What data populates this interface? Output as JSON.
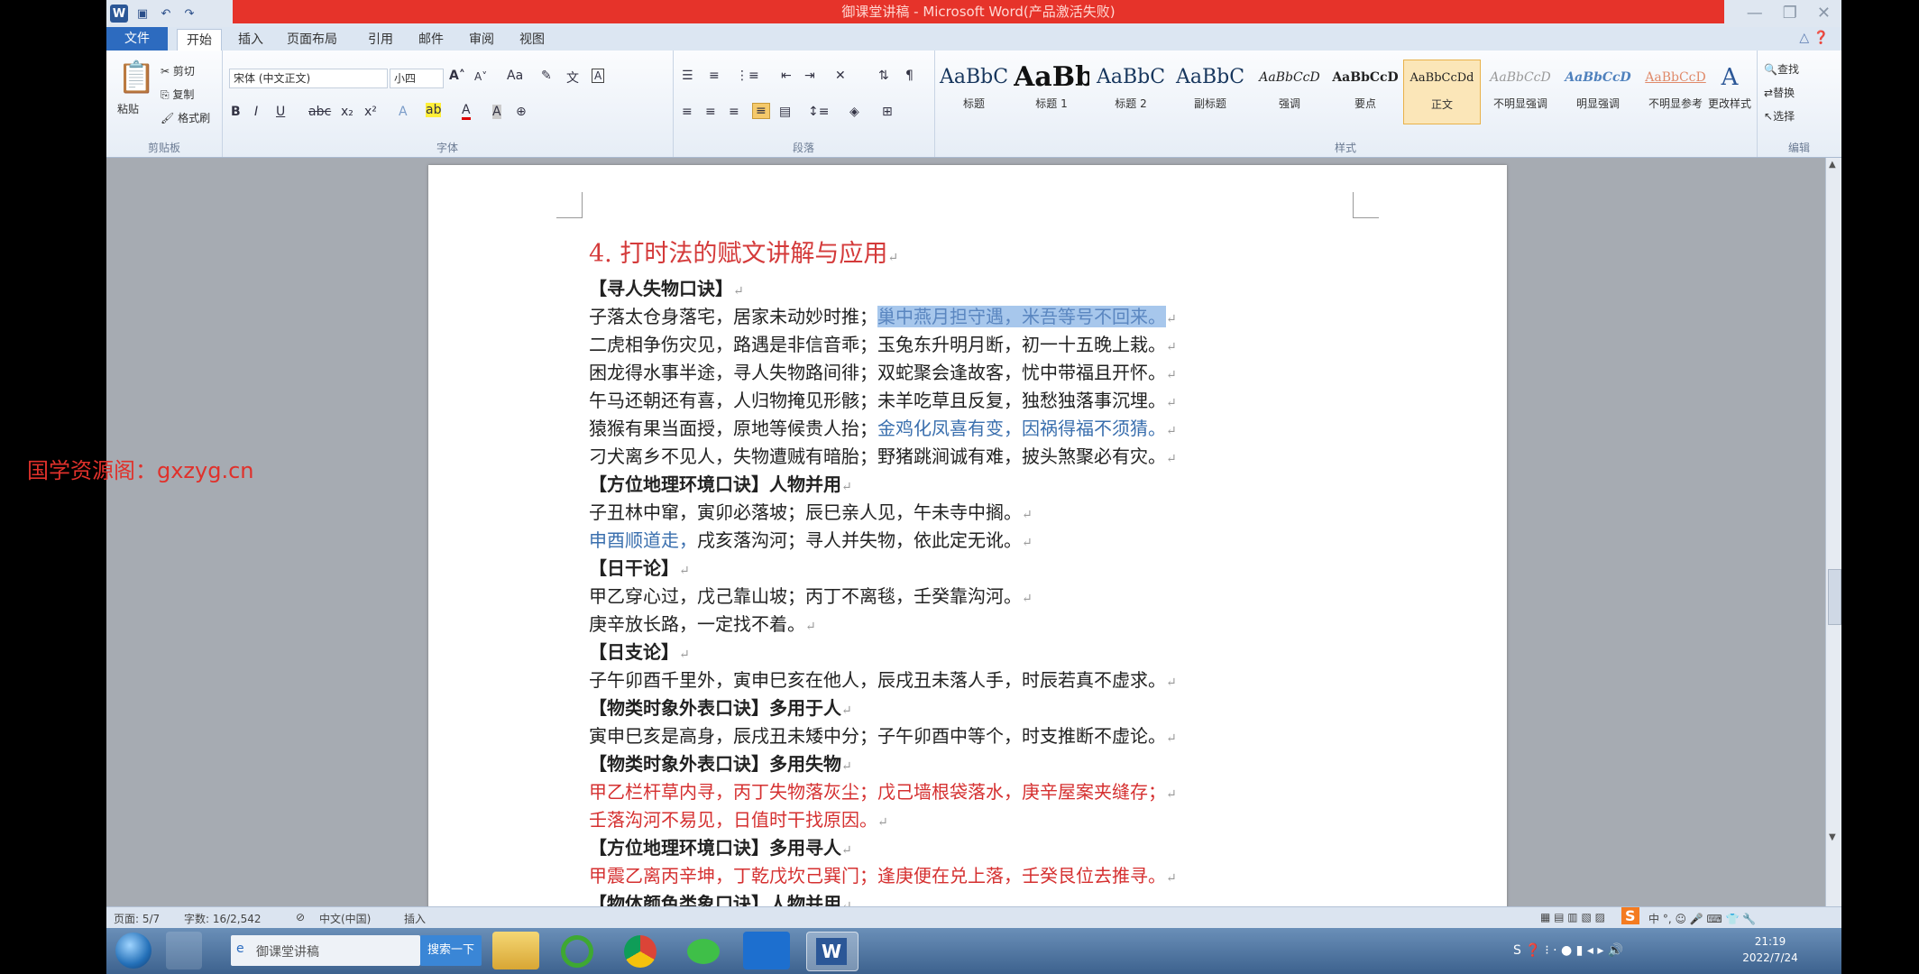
{
  "window": {
    "title": "御课堂讲稿 - Microsoft Word(产品激活失败)",
    "controls": [
      "—",
      "❐",
      "✕"
    ]
  },
  "ribbon": {
    "tabs": [
      "文件",
      "开始",
      "插入",
      "页面布局",
      "引用",
      "邮件",
      "审阅",
      "视图"
    ],
    "clipboard": {
      "paste": "粘贴",
      "cut": "剪切",
      "copy": "复制",
      "format_painter": "格式刷",
      "label": "剪贴板"
    },
    "font": {
      "name": "宋体 (中文正文)",
      "size": "小四",
      "label": "字体"
    },
    "paragraph": {
      "label": "段落"
    },
    "styles": {
      "label": "样式",
      "items": [
        {
          "sample": "AaBbC",
          "name": "标题"
        },
        {
          "sample": "AaBb",
          "name": "标题 1"
        },
        {
          "sample": "AaBbC",
          "name": "标题 2"
        },
        {
          "sample": "AaBbC",
          "name": "副标题"
        },
        {
          "sample": "AaBbCcD",
          "name": "强调"
        },
        {
          "sample": "AaBbCcD",
          "name": "要点"
        },
        {
          "sample": "AaBbCcDd",
          "name": "正文"
        },
        {
          "sample": "AaBbCcD",
          "name": "不明显强调"
        },
        {
          "sample": "AaBbCcD",
          "name": "明显强调"
        },
        {
          "sample": "AaBbCcD",
          "name": "不明显参考"
        }
      ],
      "change_styles": "更改样式"
    },
    "editing": {
      "find": "查找",
      "replace": "替换",
      "select": "选择",
      "label": "编辑"
    }
  },
  "document": {
    "heading": "4. 打时法的赋文讲解与应用",
    "lines": [
      {
        "segments": [
          {
            "t": "【寻人失物口诀】",
            "c": "bold"
          }
        ]
      },
      {
        "segments": [
          {
            "t": "子落太仓身落宅，居家未动妙时推；",
            "c": ""
          },
          {
            "t": "巢中燕月担守遇，米吾等号不回来。",
            "c": "hl"
          }
        ]
      },
      {
        "segments": [
          {
            "t": "二虎相争伤灾见，路遇是非信音乖；玉兔东升明月断，初一十五晚上栽。",
            "c": ""
          }
        ]
      },
      {
        "segments": [
          {
            "t": "困龙得水事半途，寻人失物路间徘；双蛇聚会逢故客，忧中带福且开怀。",
            "c": ""
          }
        ]
      },
      {
        "segments": [
          {
            "t": "午马还朝还有喜，人归物掩见形骸；未羊吃草且反复，独愁独落事沉埋。",
            "c": ""
          }
        ]
      },
      {
        "segments": [
          {
            "t": "猿猴有果当面授，原地等候贵人抬；",
            "c": ""
          },
          {
            "t": "金鸡化凤喜有变，因祸得福不须猜。",
            "c": "blue"
          }
        ]
      },
      {
        "segments": [
          {
            "t": "刁犬离乡不见人，失物遭贼有暗胎；野猪跳涧诚有难，披头煞聚必有灾。",
            "c": ""
          }
        ]
      },
      {
        "segments": [
          {
            "t": "【方位地理环境口诀】人物并用",
            "c": "bold"
          }
        ]
      },
      {
        "segments": [
          {
            "t": "子丑林中窜，寅卯必落坡；辰巳亲人见，午未寺中搁。",
            "c": ""
          }
        ]
      },
      {
        "segments": [
          {
            "t": "申酉顺道走，",
            "c": "blue"
          },
          {
            "t": "戌亥落沟河；寻人并失物，依此定无讹。",
            "c": ""
          }
        ]
      },
      {
        "segments": [
          {
            "t": "【日干论】",
            "c": "bold"
          }
        ]
      },
      {
        "segments": [
          {
            "t": "甲乙穿心过，戊己靠山坡；丙丁不离毯，壬癸靠沟河。",
            "c": ""
          }
        ]
      },
      {
        "segments": [
          {
            "t": "庚辛放长路，一定找不着。",
            "c": ""
          }
        ]
      },
      {
        "segments": [
          {
            "t": "【日支论】",
            "c": "bold"
          }
        ]
      },
      {
        "segments": [
          {
            "t": "子午卯酉千里外，寅申巳亥在他人，辰戌丑未落人手，时辰若真不虚求。",
            "c": ""
          }
        ]
      },
      {
        "segments": [
          {
            "t": "【物类时象外表口诀】多用于人",
            "c": "bold"
          }
        ]
      },
      {
        "segments": [
          {
            "t": "寅申巳亥是高身，辰戌丑未矮中分；子午卯酉中等个，时支推断不虚论。",
            "c": ""
          }
        ]
      },
      {
        "segments": [
          {
            "t": "【物类时象外表口诀】多用失物",
            "c": "bold"
          }
        ]
      },
      {
        "segments": [
          {
            "t": "甲乙栏杆草内寻，丙丁失物落灰尘；戊己墙根袋落水，庚辛屋案夹缝存；",
            "c": "red"
          }
        ]
      },
      {
        "segments": [
          {
            "t": "壬落沟河不易见，日值时干找原因。",
            "c": "red"
          }
        ]
      },
      {
        "segments": [
          {
            "t": "【方位地理环境口诀】多用寻人",
            "c": "bold"
          }
        ]
      },
      {
        "segments": [
          {
            "t": "甲震乙离丙辛坤，丁乾戊坎己巽门；逢庚便在兑上落，壬癸艮位去推寻。",
            "c": "red"
          }
        ]
      },
      {
        "segments": [
          {
            "t": "【物体颜色类象口诀】人物并用",
            "c": "bold"
          }
        ]
      }
    ]
  },
  "statusbar": {
    "page": "页面: 5/7",
    "words": "字数: 16/2,542",
    "language": "中文(中国)",
    "mode": "插入"
  },
  "taskbar": {
    "search_box": "御课堂讲稿",
    "button_label": "搜索一下",
    "time": "21:19",
    "date": "2022/7/24"
  },
  "watermark": "国学资源阁：gxzyg.cn",
  "colors": {
    "title_red": "#e6332a",
    "heading_red": "#d43a3a",
    "highlight": "#a7c7ec",
    "file_tab": "#2d6bbf"
  }
}
